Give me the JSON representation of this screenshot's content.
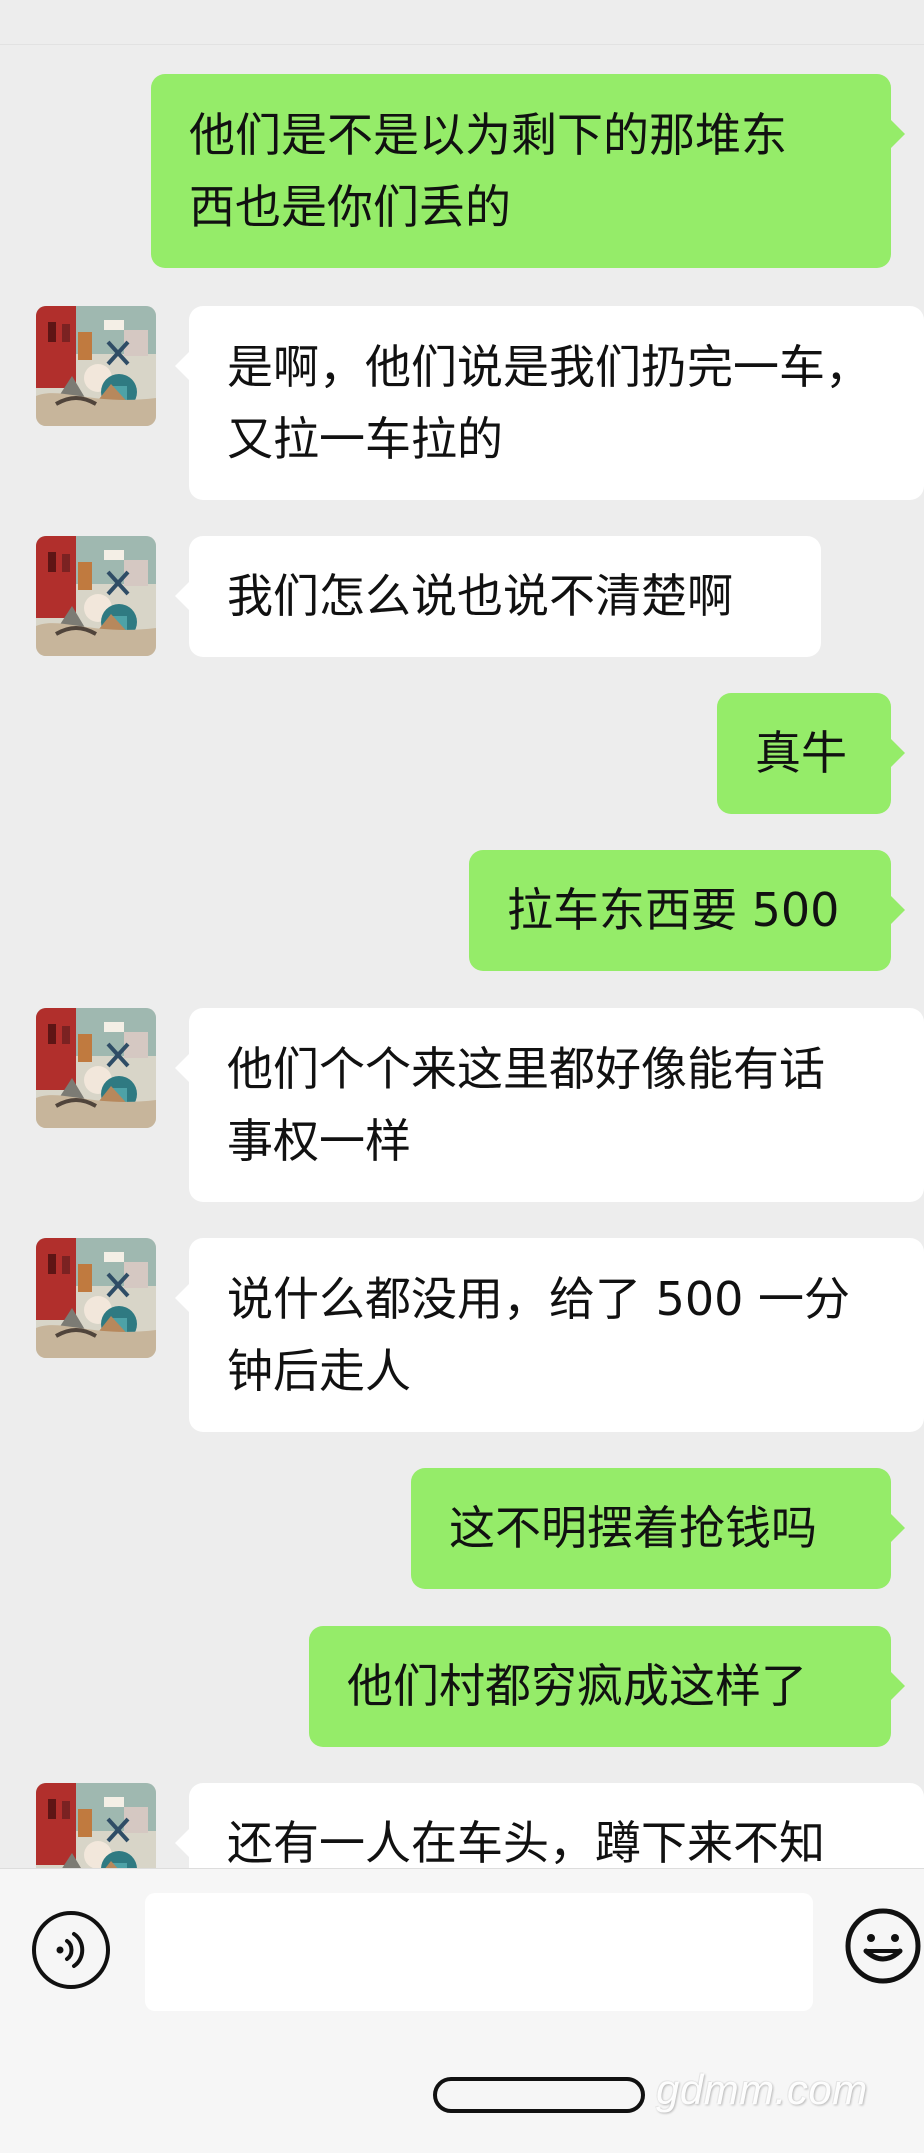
{
  "messages": [
    {
      "sender": "me",
      "text": "他们是不是以为剩下的那堆东\n西也是你们丢的"
    },
    {
      "sender": "other",
      "text": "是啊，他们说是我们扔完一车，\n又拉一车拉的"
    },
    {
      "sender": "other",
      "text": "我们怎么说也说不清楚啊"
    },
    {
      "sender": "me",
      "text": "真牛"
    },
    {
      "sender": "me",
      "text": "拉车东西要 500"
    },
    {
      "sender": "other",
      "text": "他们个个来这里都好像能有话\n事权一样"
    },
    {
      "sender": "other",
      "text": "说什么都没用，给了 500 一分\n钟后走人"
    },
    {
      "sender": "me",
      "text": "这不明摆着抢钱吗"
    },
    {
      "sender": "me",
      "text": "他们村都穷疯成这样了"
    },
    {
      "sender": "other",
      "text": "还有一人在车头，蹲下来不知"
    }
  ],
  "input_bar": {
    "voice_icon": "voice-icon",
    "emoji_icon": "emoji-icon",
    "message_value": ""
  },
  "watermark": "gdmm.com",
  "colors": {
    "background": "#ededed",
    "sent_bubble": "#95ec69",
    "received_bubble": "#ffffff"
  }
}
